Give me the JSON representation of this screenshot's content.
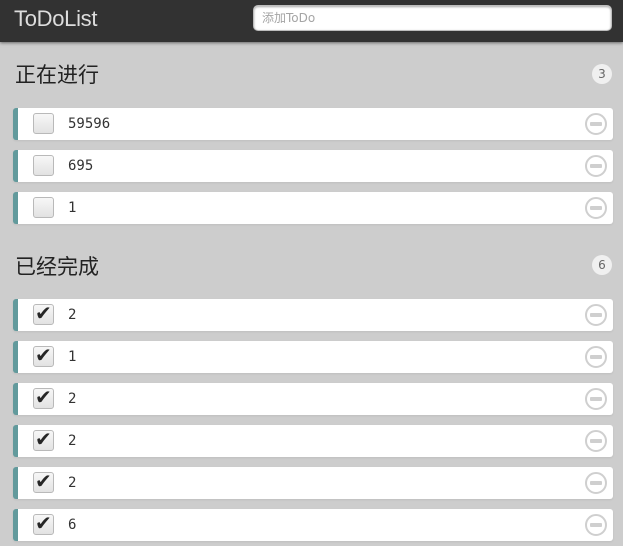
{
  "header": {
    "title": "ToDoList",
    "input_placeholder": "添加ToDo",
    "input_value": ""
  },
  "sections": {
    "ongoing": {
      "title": "正在进行",
      "count": "3",
      "items": [
        {
          "text": "59596",
          "done": false
        },
        {
          "text": "695",
          "done": false
        },
        {
          "text": "1",
          "done": false
        }
      ]
    },
    "done": {
      "title": "已经完成",
      "count": "6",
      "items": [
        {
          "text": "2",
          "done": true
        },
        {
          "text": "1",
          "done": true
        },
        {
          "text": "2",
          "done": true
        },
        {
          "text": "2",
          "done": true
        },
        {
          "text": "2",
          "done": true
        },
        {
          "text": "6",
          "done": true
        }
      ]
    }
  },
  "icons": {
    "check": "check-icon",
    "remove": "remove-icon"
  },
  "colors": {
    "header_bg": "#323232",
    "page_bg": "#cdcdcd",
    "item_accent": "#629a9c"
  }
}
